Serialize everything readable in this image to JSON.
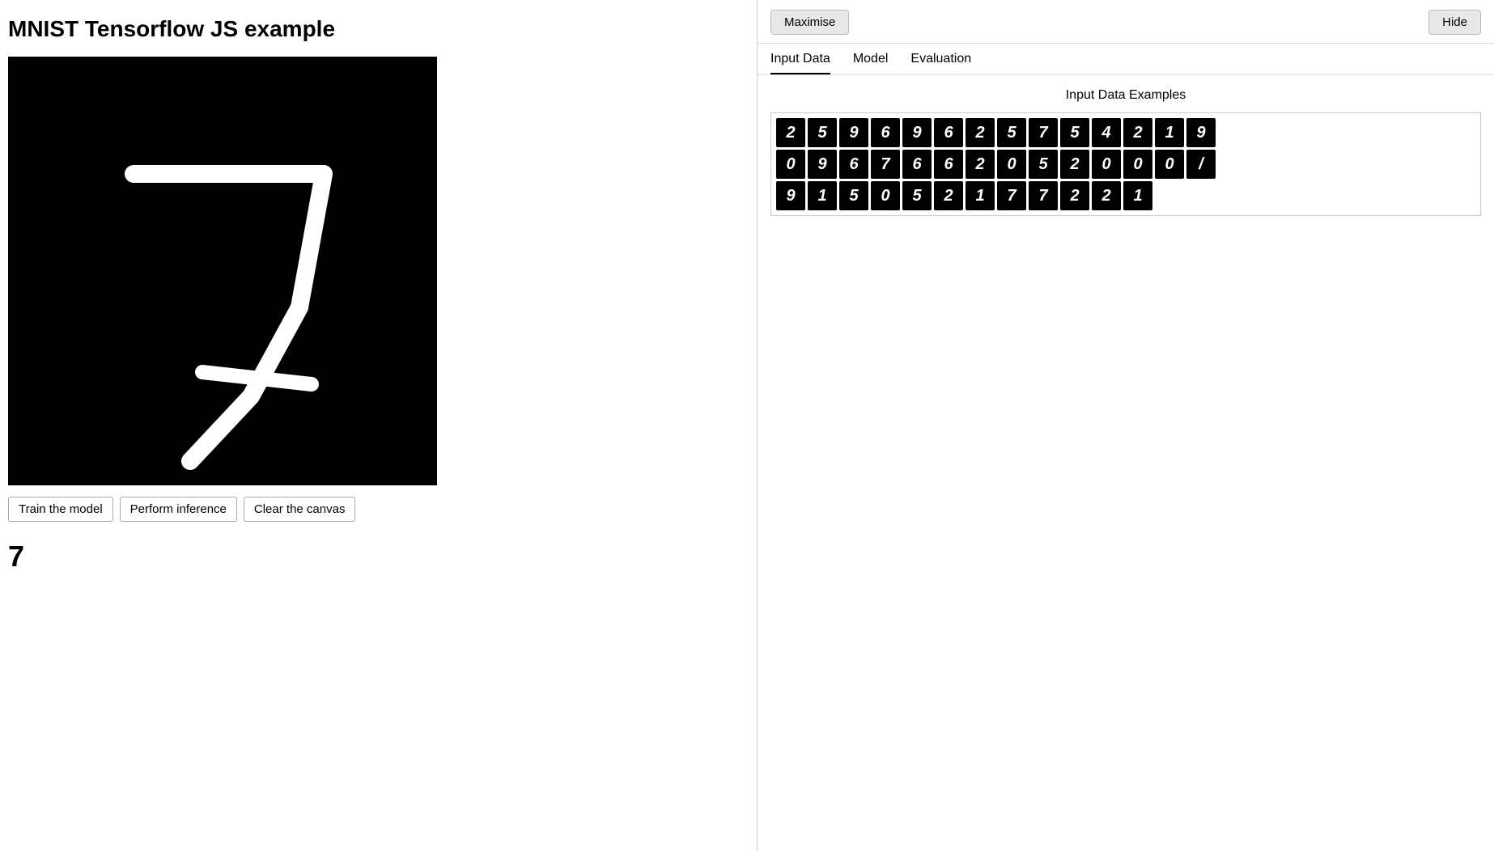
{
  "app": {
    "title": "MNIST Tensorflow JS example"
  },
  "buttons": {
    "train_label": "Train the model",
    "inference_label": "Perform inference",
    "clear_label": "Clear the canvas",
    "maximise_label": "Maximise",
    "hide_label": "Hide"
  },
  "inference_result": "7",
  "tabs": [
    {
      "label": "Input Data",
      "active": true
    },
    {
      "label": "Model",
      "active": false
    },
    {
      "label": "Evaluation",
      "active": false
    }
  ],
  "input_data_section": {
    "title": "Input Data Examples"
  },
  "mnist_rows": [
    [
      "2",
      "5",
      "9",
      "6",
      "9",
      "6",
      "2",
      "5",
      "7",
      "5",
      "4",
      "2",
      "1",
      "9"
    ],
    [
      "0",
      "9",
      "6",
      "7",
      "6",
      "6",
      "2",
      "0",
      "5",
      "2",
      "0",
      "0",
      "0",
      "/"
    ],
    [
      "9",
      "1",
      "5",
      "0",
      "5",
      "2",
      "1",
      "7",
      "7",
      "2",
      "2",
      "1",
      "",
      ""
    ]
  ]
}
